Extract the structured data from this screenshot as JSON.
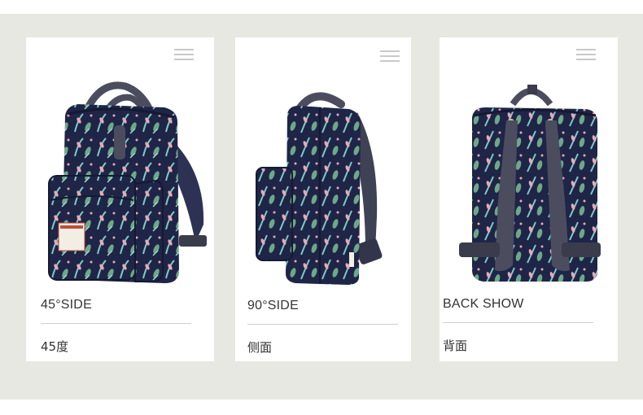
{
  "views": [
    {
      "title": "45°SIDE",
      "subtitle": "45度",
      "photo": "backpack-45-degree-view"
    },
    {
      "title": "90°SIDE",
      "subtitle": "侧面",
      "photo": "backpack-side-view"
    },
    {
      "title": "BACK SHOW",
      "subtitle": "背面",
      "photo": "backpack-back-view"
    }
  ],
  "colors": {
    "background_band": "#e8e8e3",
    "card": "#ffffff",
    "backpack_navy": "#1f2547",
    "strap_gray": "#4b4d5f",
    "leaf_teal": "#7fc9c6",
    "leaf_pink": "#e9a9b6",
    "leaf_green": "#6da889"
  },
  "icons": [
    "menu-icon"
  ]
}
